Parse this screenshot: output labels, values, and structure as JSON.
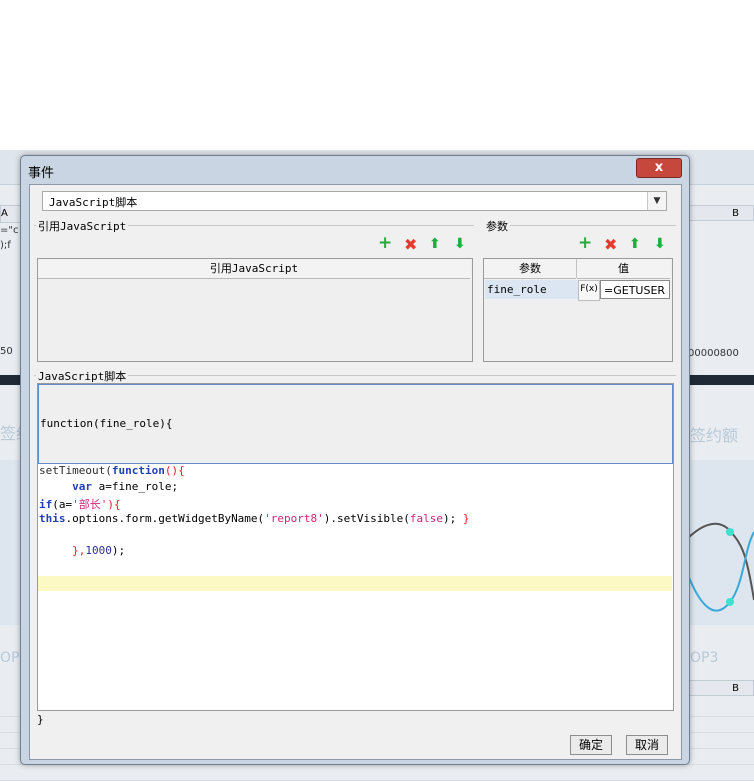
{
  "dialog": {
    "title": "事件",
    "close_label": "x",
    "event_type": "JavaScript脚本",
    "ok_label": "确定",
    "cancel_label": "取消"
  },
  "references": {
    "group_title": "引用JavaScript",
    "column_header": "引用JavaScript"
  },
  "params": {
    "group_title": "参数",
    "headers": {
      "name": "参数",
      "value": "值"
    },
    "rows": [
      {
        "name": "fine_role",
        "fx": "F(x)",
        "value": "=GETUSER"
      }
    ]
  },
  "script": {
    "group_title": "JavaScript脚本",
    "header_line": "function(fine_role){",
    "lines": [
      {
        "parts": [
          "setTimeout(",
          "function",
          "(){"
        ]
      },
      {
        "parts": [
          "     ",
          "var",
          " a=fine_role;"
        ]
      },
      {
        "parts": [
          "if",
          "(a=",
          "'部长'",
          "){"
        ]
      },
      {
        "parts": [
          "this",
          ".options.form.getWidgetByName(",
          "'report8'",
          ").setVisible(",
          "false",
          "); ",
          "}"
        ]
      },
      {
        "parts": []
      },
      {
        "parts": [
          "     },",
          "1000",
          ");"
        ]
      }
    ],
    "footer_line": "}"
  },
  "background": {
    "col_a": "A",
    "col_b": "B",
    "col_b2": "B",
    "snippet1": "=\"c",
    "snippet2": ");f",
    "numbers_left": "50",
    "numbers_right": "00000800",
    "faded_left": "签约",
    "faded_right": "签约额",
    "top_left": "OP3",
    "top_right": "OP3"
  },
  "colors": {
    "accent_green": "#1fae3c",
    "delete_red": "#e53b2f",
    "keyword_blue": "#1f3fb4",
    "string_pink": "#d4237a",
    "current_line": "#fdf9c4"
  }
}
